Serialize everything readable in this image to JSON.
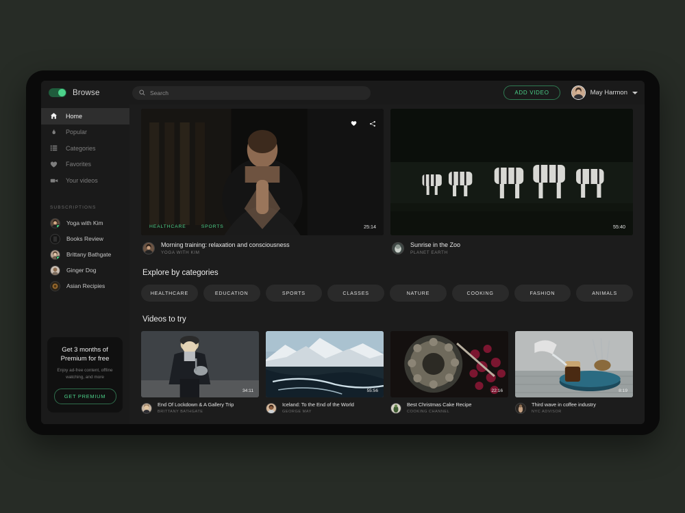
{
  "theme": {
    "page_background": "#272c26",
    "device_bezel": "#0a0a0a",
    "app_background": "#1c1c1c",
    "panel_background": "#1a1a1a",
    "accent_green": "#4cd28a",
    "text_primary": "#ededed",
    "text_muted": "#7e7e7e"
  },
  "topbar": {
    "toggle_state": "on",
    "brand_label": "Browse",
    "search": {
      "placeholder": "Search",
      "value": "",
      "icon": "search-icon"
    },
    "add_video_label": "ADD VIDEO",
    "user": {
      "name": "May Harmon",
      "avatar": "avatar",
      "caret_icon": "chevron-down-icon"
    }
  },
  "sidebar": {
    "nav": [
      {
        "label": "Home",
        "icon": "home-icon",
        "active": true
      },
      {
        "label": "Popular",
        "icon": "flame-icon",
        "active": false
      },
      {
        "label": "Categories",
        "icon": "list-icon",
        "active": false
      },
      {
        "label": "Favorites",
        "icon": "heart-icon",
        "active": false
      },
      {
        "label": "Your videos",
        "icon": "video-camera-icon",
        "active": false
      }
    ],
    "subscriptions_label": "SUBSCRIPTIONS",
    "subscriptions": [
      {
        "label": "Yoga with Kim",
        "online": true
      },
      {
        "label": "Books Review",
        "online": false
      },
      {
        "label": "Brittany Bathgate",
        "online": true
      },
      {
        "label": "Ginger Dog",
        "online": false
      },
      {
        "label": "Asian Recipies",
        "online": false
      }
    ],
    "premium": {
      "title": "Get 3 months of Premium for free",
      "subtitle": "Enjoy ad-free content, offline watching, and more",
      "button_label": "GET PREMIUM"
    }
  },
  "main": {
    "hero": [
      {
        "title": "Morning training: relaxation and consciousness",
        "channel": "YOGA WITH KIM",
        "duration": "25:14",
        "tags": [
          "HEALTHCARE",
          "SPORTS"
        ],
        "has_actions": true,
        "fav_icon": "heart-icon",
        "share_icon": "share-icon"
      },
      {
        "title": "Sunrise in the Zoo",
        "channel": "PLANET EARTH",
        "duration": "55:40",
        "tags": [],
        "has_actions": false
      }
    ],
    "categories_heading": "Explore by categories",
    "categories": [
      "HEALTHCARE",
      "EDUCATION",
      "SPORTS",
      "CLASSES",
      "NATURE",
      "COOKING",
      "FASHION",
      "ANIMALS"
    ],
    "try_heading": "Videos to try",
    "try_videos": [
      {
        "title": "End Of Lockdown & A Gallery Trip",
        "channel": "BRITTANY BATHGATE",
        "duration": "34:11"
      },
      {
        "title": "Iceland: To the End of the World",
        "channel": "GEORGE MAY",
        "duration": "55:56"
      },
      {
        "title": "Best Christmas Cake Recipe",
        "channel": "COOKING CHANNEL",
        "duration": "22:16"
      },
      {
        "title": "Third wave in coffee industry",
        "channel": "NYC ADVISOR",
        "duration": "8:19"
      }
    ]
  }
}
